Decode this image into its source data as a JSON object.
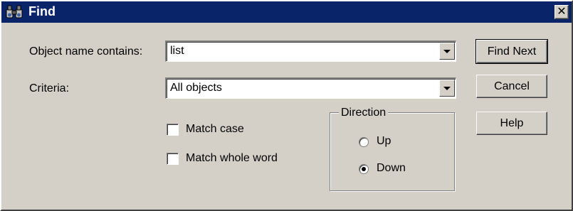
{
  "window": {
    "title": "Find"
  },
  "icons": {
    "title": "binoculars-icon",
    "close": "close-icon"
  },
  "close_glyph": "✕",
  "fields": {
    "object_name": {
      "label": "Object name contains:",
      "value": "list"
    },
    "criteria": {
      "label": "Criteria:",
      "value": "All objects"
    }
  },
  "options": {
    "match_case": {
      "label": "Match case",
      "checked": false
    },
    "match_whole_word": {
      "label": "Match whole word",
      "checked": false
    }
  },
  "direction": {
    "label": "Direction",
    "up": {
      "label": "Up",
      "selected": false
    },
    "down": {
      "label": "Down",
      "selected": true
    }
  },
  "buttons": {
    "find_next": "Find Next",
    "cancel": "Cancel",
    "help": "Help"
  },
  "colors": {
    "titlebar": "#0a246a",
    "face": "#d4d0c8"
  }
}
